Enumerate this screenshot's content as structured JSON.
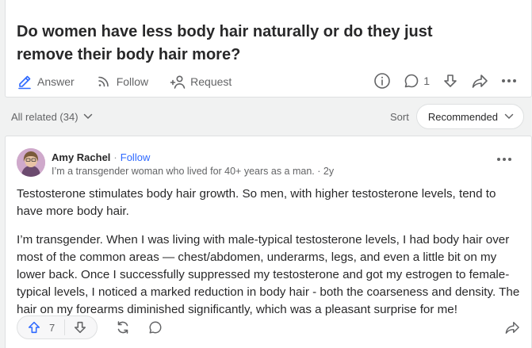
{
  "question": {
    "title": "Do women have less body hair naturally or do they just remove their body hair more?",
    "actions": {
      "answer_label": "Answer",
      "follow_label": "Follow",
      "request_label": "Request"
    },
    "comment_count": "1"
  },
  "related": {
    "label": "All related (34)",
    "sort_label": "Sort",
    "sort_value": "Recommended"
  },
  "answer": {
    "author_name": "Amy Rachel",
    "separator": "·",
    "follow_label": "Follow",
    "credential": "I’m a transgender woman who lived for 40+ years as a man. · 2y",
    "paragraphs": [
      "Testosterone stimulates body hair growth. So men, with higher testosterone levels, tend to have more body hair.",
      "I’m transgender. When I was living with male-typical testosterone levels, I had body hair over most of the common areas — chest/abdomen, underarms, legs, and even a little bit on my lower back. Once I successfully suppressed my testosterone and got my estrogen to female-typical levels, I noticed a marked reduction in body hair - both the coarseness and density. The hair on my forearms diminished significantly, which was a pleasant surprise for me!"
    ],
    "upvote_count": "7"
  },
  "colors": {
    "accent": "#2e69ff",
    "text": "#282829",
    "muted": "#636466",
    "background": "#f1f2f2"
  },
  "icons": [
    "pencil-icon",
    "follow-wifi-icon",
    "request-person-icon",
    "info-icon",
    "comment-icon",
    "downvote-icon",
    "share-icon",
    "more-icon",
    "chevron-down-icon",
    "upvote-icon",
    "reshare-icon"
  ]
}
